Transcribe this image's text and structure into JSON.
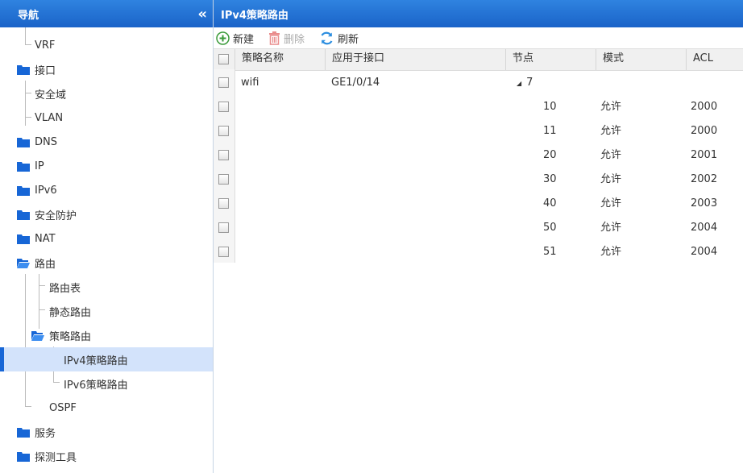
{
  "nav": {
    "title": "导航",
    "items": [
      {
        "label": "VRF"
      },
      {
        "label": "接口"
      },
      {
        "label": "安全域"
      },
      {
        "label": "VLAN"
      },
      {
        "label": "DNS"
      },
      {
        "label": "IP"
      },
      {
        "label": "IPv6"
      },
      {
        "label": "安全防护"
      },
      {
        "label": "NAT"
      },
      {
        "label": "路由"
      },
      {
        "label": "路由表"
      },
      {
        "label": "静态路由"
      },
      {
        "label": "策略路由"
      },
      {
        "label": "IPv4策略路由"
      },
      {
        "label": "IPv6策略路由"
      },
      {
        "label": "OSPF"
      },
      {
        "label": "服务"
      },
      {
        "label": "探测工具"
      }
    ]
  },
  "main": {
    "title": "IPv4策略路由",
    "toolbar": {
      "new_label": "新建",
      "delete_label": "删除",
      "refresh_label": "刷新"
    },
    "columns": [
      "策略名称",
      "应用于接口",
      "节点",
      "模式",
      "ACL"
    ],
    "group": {
      "name": "wifi",
      "interface": "GE1/0/14",
      "node": "7"
    },
    "rows": [
      {
        "node": "10",
        "mode": "允许",
        "acl": "2000"
      },
      {
        "node": "11",
        "mode": "允许",
        "acl": "2000"
      },
      {
        "node": "20",
        "mode": "允许",
        "acl": "2001"
      },
      {
        "node": "30",
        "mode": "允许",
        "acl": "2002"
      },
      {
        "node": "40",
        "mode": "允许",
        "acl": "2003"
      },
      {
        "node": "50",
        "mode": "允许",
        "acl": "2004"
      },
      {
        "node": "51",
        "mode": "允许",
        "acl": "2004"
      }
    ]
  },
  "colors": {
    "header_blue": "#1a63c8",
    "selected_bg": "#d3e3fb",
    "folder_blue": "#1766d6"
  }
}
